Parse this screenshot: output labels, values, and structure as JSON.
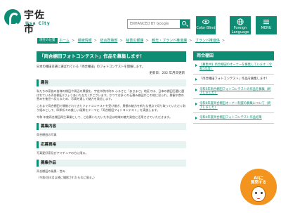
{
  "header": {
    "logo_jp": "宇佐市",
    "logo_en": "Usa City",
    "search_placeholder": "ENHANCED BY Google",
    "buttons": [
      {
        "label": "Color Blind",
        "icon": "eye-icon"
      },
      {
        "label": "Foreign Language",
        "icon": "globe-icon"
      },
      {
        "label": "MENU",
        "icon": "menu-icon"
      }
    ]
  },
  "breadcrumb": {
    "badge": "現在の位置",
    "items": [
      "ホーム",
      "組織情報",
      "総合政策部",
      "秘書広報課",
      "観光・ブランド推進課",
      "ブランド推進係"
    ],
    "current": "「両合棚田フォトコンテスト」作品を募集します！"
  },
  "main": {
    "title": "「両合棚田フォトコンテスト」作品を募集します！",
    "intro": "日本の棚田百選に選ばれている「両合棚田」のフォトコンテストを開催します。",
    "updated": "更新日：202 年月日更新",
    "sections": [
      {
        "heading": "趣旨",
        "paragraphs": [
          "私たちの家族の皆様の棚田や周辺の景観を、宇佐市院内町の ふるさと「あきまさ」地区では、日本の棚田百選に選ばれている両合棚田 (りょうあいたなだ) がございます。かつては多くの石積み棚田がこの地に見られ、景観や食の恵みを後世へ伝えるため、写真を通して魅力を発信します。",
          "これまで両合棚田で開催されてきたフォトコンテストを受け継ぎ、景観の魅力を新たな視点で切り取っていただく取り組みとして、四季折々の美しい風景をテーマに「両合棚田フォトコンテスト」を実施します。",
          "令和 年度両合棚田再生事業として、ご応募いただいた作品は地域の魅力発信に活用させていただきます。"
        ]
      },
      {
        "heading": "募集内容",
        "paragraphs": [
          "両合棚田の写真"
        ]
      },
      {
        "heading": "応募資格",
        "paragraphs": [
          "写真愛好家及びアマチュアの方に限る。"
        ]
      },
      {
        "heading": "募集作品",
        "paragraphs": [
          "両合棚田の風景・営み",
          "（令和4年4月以降に撮影されたものに限る。）"
        ]
      }
    ]
  },
  "sidebar": {
    "heading": "両合棚田",
    "items": [
      "【募集中】両合棚田のオーナーを募集しています（令和5年度）",
      "「両合棚田フォトコンテスト」作品を募集します！",
      "令和5年両合棚田フォトコンテストの作品を募集（終了しました）",
      "令和6年度両合棚田オーナー制度の募集について（終了しました）",
      "令和4年度両合棚田フォトコンテスト作品結果"
    ]
  },
  "chat": {
    "line1": "AIに",
    "line2": "質問する"
  },
  "colors": {
    "brand": "#0f8d74",
    "accent": "#f2941e"
  }
}
